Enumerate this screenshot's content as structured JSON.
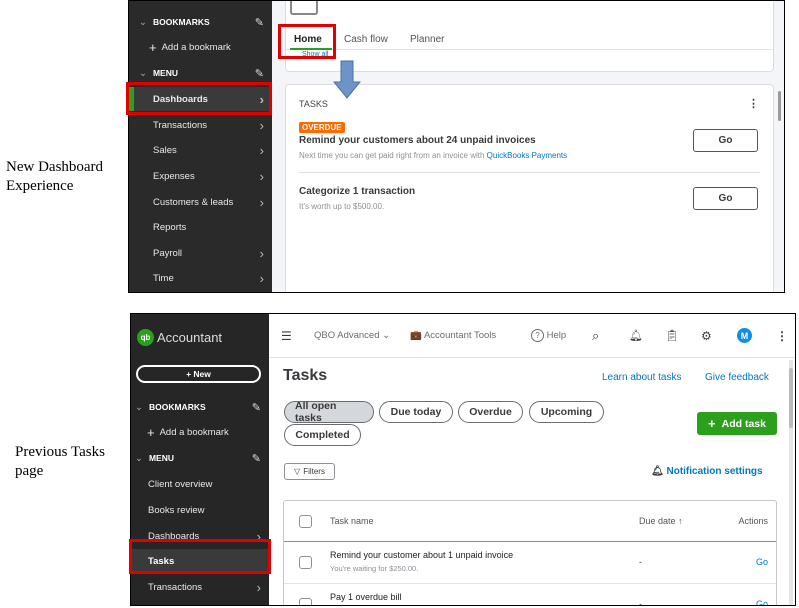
{
  "captions": {
    "new": "New Dashboard Experience",
    "previous": "Previous Tasks page"
  },
  "top": {
    "sidebar": {
      "bookmarks": "BOOKMARKS",
      "add_bookmark": "Add a bookmark",
      "menu": "MENU",
      "items": [
        "Dashboards",
        "Transactions",
        "Sales",
        "Expenses",
        "Customers & leads",
        "Reports",
        "Payroll",
        "Time"
      ]
    },
    "tabs": [
      "Home",
      "Cash flow",
      "Planner"
    ],
    "show_all": "Show all",
    "tasks": {
      "title": "TASKS",
      "items": [
        {
          "badge": "OVERDUE",
          "title": "Remind your customers about 24 unpaid invoices",
          "sub": "Next time you can get paid right from an invoice with ",
          "link": "QuickBooks Payments",
          "action": "Go"
        },
        {
          "title": "Categorize 1 transaction",
          "sub": "It's worth up to $500.00.",
          "action": "Go"
        }
      ]
    }
  },
  "bottom": {
    "logo": "Accountant",
    "new_button": "+ New",
    "sidebar": {
      "bookmarks": "BOOKMARKS",
      "add_bookmark": "Add a bookmark",
      "menu": "MENU",
      "items": [
        "Client overview",
        "Books review",
        "Dashboards",
        "Tasks",
        "Transactions"
      ]
    },
    "topbar": {
      "company": "QBO Advanced",
      "tools": "Accountant Tools",
      "help": "Help",
      "avatar": "M"
    },
    "title": "Tasks",
    "learn": "Learn about tasks",
    "feedback": "Give feedback",
    "filters": [
      "All open tasks",
      "Due today",
      "Overdue",
      "Upcoming",
      "Completed"
    ],
    "add_task": "Add task",
    "filters_btn": "Filters",
    "notification": "Notification settings",
    "table": {
      "headers": [
        "Task name",
        "Due date ↑",
        "Actions"
      ],
      "rows": [
        {
          "name": "Remind your customer about 1 unpaid invoice",
          "sub": "You're waiting for $250.00.",
          "due": "-",
          "action": "Go"
        },
        {
          "name": "Pay 1 overdue bill",
          "sub": "",
          "due": "-",
          "action": "Go"
        }
      ]
    }
  },
  "colors": {
    "accent_green": "#2ca01c",
    "link_blue": "#0077c5",
    "overdue_orange": "#ff6a00",
    "highlight_red": "#e00000",
    "arrow_blue": "#6d93c9"
  }
}
